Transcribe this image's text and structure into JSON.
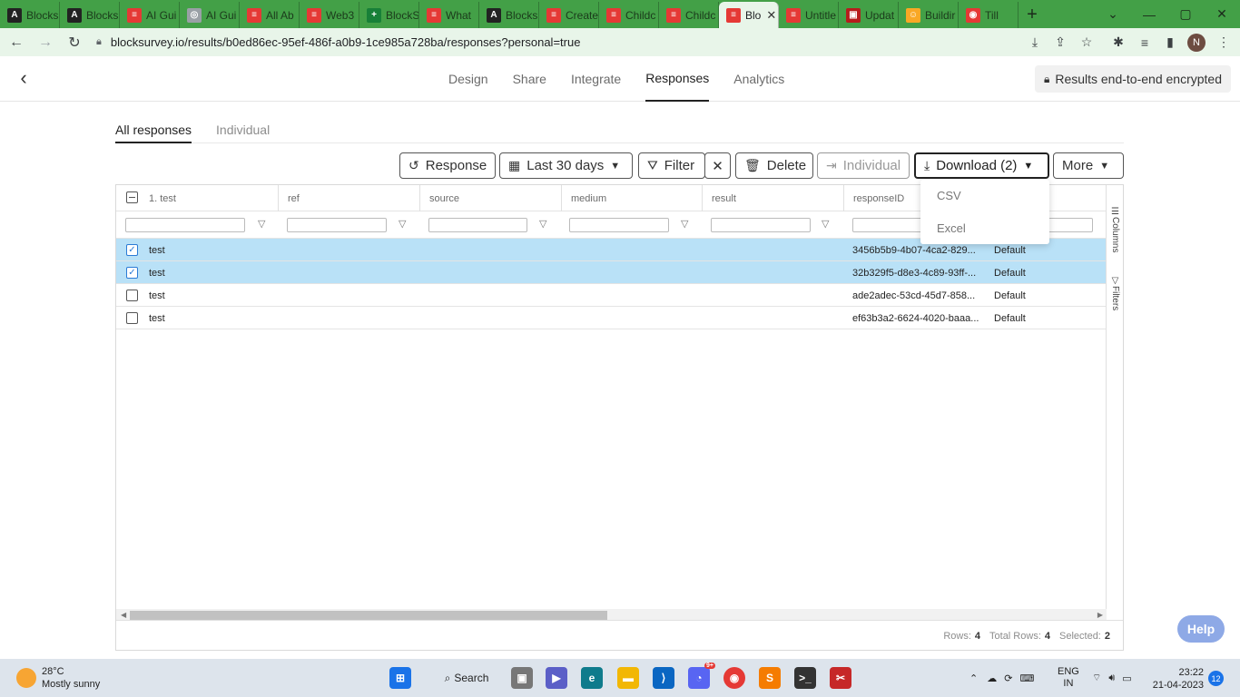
{
  "browser": {
    "tabs": [
      {
        "label": "Blocks",
        "fav": "A",
        "color": "#222222"
      },
      {
        "label": "Blocks",
        "fav": "A",
        "color": "#222222"
      },
      {
        "label": "AI Gui",
        "fav": "≡",
        "color": "#e53935"
      },
      {
        "label": "AI Gui",
        "fav": "◎",
        "color": "#9aa0a6"
      },
      {
        "label": "All Ab",
        "fav": "≡",
        "color": "#e53935"
      },
      {
        "label": "Web3",
        "fav": "≡",
        "color": "#e53935"
      },
      {
        "label": "BlockS",
        "fav": "+",
        "color": "#188038"
      },
      {
        "label": "What",
        "fav": "≡",
        "color": "#e53935"
      },
      {
        "label": "Blocks",
        "fav": "A",
        "color": "#222222"
      },
      {
        "label": "Create",
        "fav": "≡",
        "color": "#e53935"
      },
      {
        "label": "Childc",
        "fav": "≡",
        "color": "#e53935"
      },
      {
        "label": "Childc",
        "fav": "≡",
        "color": "#e53935"
      },
      {
        "label": "Blo",
        "fav": "≡",
        "color": "#e53935",
        "active": true
      },
      {
        "label": "Untitle",
        "fav": "≡",
        "color": "#e53935"
      },
      {
        "label": "Updat",
        "fav": "▣",
        "color": "#b71c1c"
      },
      {
        "label": "Buildir",
        "fav": "☺",
        "color": "#f9a825"
      },
      {
        "label": "Till",
        "fav": "◉",
        "color": "#e53935"
      }
    ],
    "url": "blocksurvey.io/results/b0ed86ec-95ef-486f-a0b9-1ce985a728ba/responses?personal=true",
    "profile_initial": "N"
  },
  "app": {
    "nav": [
      "Design",
      "Share",
      "Integrate",
      "Responses",
      "Analytics"
    ],
    "active_nav": "Responses",
    "encryption_badge": "Results end-to-end encrypted",
    "subtabs": [
      "All responses",
      "Individual"
    ],
    "actions": {
      "response": "Response",
      "date_range": "Last 30 days",
      "filter": "Filter",
      "clear": "✕",
      "delete": "Delete",
      "individual": "Individual",
      "download": "Download (2)",
      "more": "More"
    },
    "download_menu": [
      "CSV",
      "Excel"
    ],
    "columns": [
      "1. test",
      "ref",
      "source",
      "medium",
      "result",
      "responseID"
    ],
    "side_panels": [
      "Columns",
      "Filters"
    ],
    "rows": [
      {
        "test": "test",
        "responseID": "3456b5b9-4b07-4ca2-829...",
        "extra": "Default",
        "selected": true
      },
      {
        "test": "test",
        "responseID": "32b329f5-d8e3-4c89-93ff-...",
        "extra": "Default",
        "selected": true
      },
      {
        "test": "test",
        "responseID": "ade2adec-53cd-45d7-858...",
        "extra": "Default",
        "selected": false
      },
      {
        "test": "test",
        "responseID": "ef63b3a2-6624-4020-baaa...",
        "extra": "Default",
        "selected": false
      }
    ],
    "footer": {
      "rows_label": "Rows:",
      "rows": "4",
      "total_label": "Total Rows:",
      "total": "4",
      "selected_label": "Selected:",
      "selected": "2"
    },
    "help": "Help"
  },
  "taskbar": {
    "temp": "28°C",
    "weather": "Mostly sunny",
    "search": "Search",
    "lang": "ENG",
    "region": "IN",
    "time": "23:22",
    "date": "21-04-2023",
    "notifications": "12",
    "discord_badge": "9+"
  }
}
